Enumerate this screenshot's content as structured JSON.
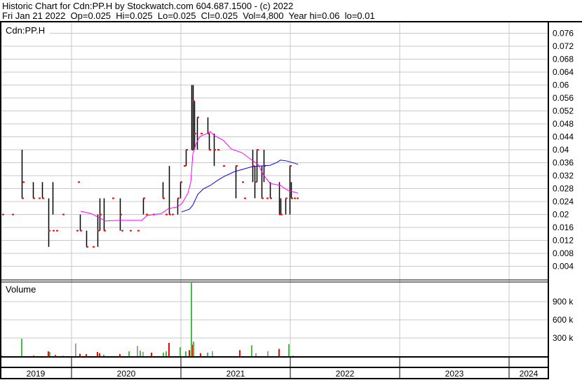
{
  "header": {
    "title": "Historic Chart for Cdn:PP.H by Stockwatch.com 604.687.1500 - (c) 2022",
    "summary": "Fri Jan 21 2022  Op=0.025  Hi=0.025  Lo=0.025  Cl=0.025  Vol=4,800  Year hi=0.06  lo=0.01"
  },
  "colors": {
    "close": "#ff0000",
    "ma_short": "#ff00ff",
    "ma_long": "#0000ff",
    "vol_up": "#44bb44",
    "vol_down": "#ff0000",
    "vol_flat": "#a0a0a0",
    "grid": "#c8c8c8"
  },
  "chart_data": [
    {
      "type": "line",
      "title": "Cdn:PP.H",
      "ylim": [
        0,
        0.08
      ],
      "y_ticks": [
        "0.004",
        "0.008",
        "0.012",
        "0.016",
        "0.02",
        "0.024",
        "0.028",
        "0.032",
        "0.036",
        "0.04",
        "0.044",
        "0.048",
        "0.052",
        "0.056",
        "0.06",
        "0.064",
        "0.068",
        "0.072",
        "0.076"
      ],
      "x_years": [
        "2019",
        "2020",
        "2021",
        "2022",
        "2023",
        "2024"
      ],
      "bars_t_hi_lo_close": [
        [
          2019.365,
          0.02,
          0.02,
          0.02
        ],
        [
          2019.455,
          0.02,
          0.02,
          0.02
        ],
        [
          2019.545,
          0.04,
          0.025,
          0.025
        ],
        [
          2019.551,
          0.03,
          0.03,
          0.03
        ],
        [
          2019.647,
          0.03,
          0.025,
          0.025
        ],
        [
          2019.699,
          0.025,
          0.025,
          0.025
        ],
        [
          2019.731,
          0.03,
          0.025,
          0.025
        ],
        [
          2019.788,
          0.025,
          0.01,
          0.015
        ],
        [
          2019.827,
          0.03,
          0.02,
          0.015
        ],
        [
          2019.859,
          0.015,
          0.015,
          0.015
        ],
        [
          2019.917,
          0.02,
          0.02,
          0.02
        ],
        [
          2020.045,
          0.015,
          0.015,
          0.015
        ],
        [
          2020.058,
          0.03,
          0.03,
          0.03
        ],
        [
          2020.077,
          0.02,
          0.015,
          0.015
        ],
        [
          2020.135,
          0.015,
          0.01,
          0.01
        ],
        [
          2020.192,
          0.01,
          0.01,
          0.01
        ],
        [
          2020.237,
          0.02,
          0.01,
          0.015
        ],
        [
          2020.256,
          0.025,
          0.015,
          0.02
        ],
        [
          2020.295,
          0.025,
          0.015,
          0.015
        ],
        [
          2020.372,
          0.025,
          0.025,
          0.025
        ],
        [
          2020.442,
          0.025,
          0.015,
          0.02
        ],
        [
          2020.455,
          0.02,
          0.02,
          0.015
        ],
        [
          2020.532,
          0.025,
          0.025,
          0.015
        ],
        [
          2020.603,
          0.015,
          0.015,
          0.015
        ],
        [
          2020.654,
          0.025,
          0.02,
          0.025
        ],
        [
          2020.679,
          0.03,
          0.03,
          0.02
        ],
        [
          2020.744,
          0.02,
          0.02,
          0.02
        ],
        [
          2020.833,
          0.03,
          0.025,
          0.025
        ],
        [
          2020.859,
          0.03,
          0.03,
          0.02
        ],
        [
          2020.891,
          0.035,
          0.02,
          0.02
        ],
        [
          2020.917,
          0.02,
          0.02,
          0.02
        ],
        [
          2020.968,
          0.025,
          0.02,
          0.025
        ],
        [
          2020.994,
          0.03,
          0.025,
          0.03
        ],
        [
          2021.026,
          0.035,
          0.035,
          0.035
        ],
        [
          2021.045,
          0.04,
          0.035,
          0.04
        ],
        [
          2021.096,
          0.06,
          0.04,
          0.04
        ],
        [
          2021.109,
          0.06,
          0.04,
          0.055
        ],
        [
          2021.122,
          0.055,
          0.04,
          0.045
        ],
        [
          2021.147,
          0.05,
          0.04,
          0.05
        ],
        [
          2021.179,
          0.045,
          0.045,
          0.045
        ],
        [
          2021.244,
          0.05,
          0.045,
          0.045
        ],
        [
          2021.256,
          0.045,
          0.04,
          0.04
        ],
        [
          2021.301,
          0.045,
          0.035,
          0.04
        ],
        [
          2021.333,
          0.04,
          0.04,
          0.04
        ],
        [
          2021.385,
          0.035,
          0.035,
          0.035
        ],
        [
          2021.5,
          0.035,
          0.025,
          0.035
        ],
        [
          2021.558,
          0.03,
          0.03,
          0.03
        ],
        [
          2021.577,
          0.025,
          0.025,
          0.025
        ],
        [
          2021.654,
          0.04,
          0.03,
          0.035
        ],
        [
          2021.673,
          0.035,
          0.025,
          0.03
        ],
        [
          2021.692,
          0.04,
          0.03,
          0.04
        ],
        [
          2021.737,
          0.035,
          0.025,
          0.025
        ],
        [
          2021.756,
          0.04,
          0.03,
          0.035
        ],
        [
          2021.782,
          0.025,
          0.025,
          0.025
        ],
        [
          2021.814,
          0.03,
          0.025,
          0.025
        ],
        [
          2021.897,
          0.03,
          0.02,
          0.02
        ],
        [
          2021.91,
          0.025,
          0.02,
          0.02
        ],
        [
          2021.955,
          0.025,
          0.02,
          0.025
        ],
        [
          2021.994,
          0.035,
          0.02,
          0.035
        ],
        [
          2022.006,
          0.03,
          0.025,
          0.025
        ],
        [
          2022.032,
          0.025,
          0.025,
          0.025
        ],
        [
          2022.058,
          0.025,
          0.025,
          0.025
        ]
      ],
      "series": [
        {
          "name": "ma_short",
          "points": [
            [
              2020.083,
              0.021
            ],
            [
              2020.179,
              0.0203
            ],
            [
              2020.276,
              0.0186
            ],
            [
              2020.308,
              0.018
            ],
            [
              2020.436,
              0.0182
            ],
            [
              2020.641,
              0.0182
            ],
            [
              2020.692,
              0.0197
            ],
            [
              2020.821,
              0.0203
            ],
            [
              2020.885,
              0.0218
            ],
            [
              2020.962,
              0.0223
            ],
            [
              2021.0,
              0.0231
            ],
            [
              2021.013,
              0.0236
            ],
            [
              2021.064,
              0.0266
            ],
            [
              2021.09,
              0.03
            ],
            [
              2021.109,
              0.0387
            ],
            [
              2021.141,
              0.042
            ],
            [
              2021.173,
              0.0441
            ],
            [
              2021.224,
              0.0448
            ],
            [
              2021.269,
              0.0456
            ],
            [
              2021.301,
              0.0445
            ],
            [
              2021.385,
              0.043
            ],
            [
              2021.462,
              0.0402
            ],
            [
              2021.558,
              0.0391
            ],
            [
              2021.641,
              0.037
            ],
            [
              2021.705,
              0.0355
            ],
            [
              2021.756,
              0.0322
            ],
            [
              2021.814,
              0.0296
            ],
            [
              2021.91,
              0.029
            ],
            [
              2021.974,
              0.0275
            ],
            [
              2022.071,
              0.0266
            ]
          ]
        },
        {
          "name": "ma_long",
          "points": [
            [
              2021.006,
              0.0208
            ],
            [
              2021.077,
              0.0216
            ],
            [
              2021.109,
              0.0229
            ],
            [
              2021.154,
              0.0262
            ],
            [
              2021.205,
              0.0279
            ],
            [
              2021.269,
              0.029
            ],
            [
              2021.333,
              0.0305
            ],
            [
              2021.397,
              0.0318
            ],
            [
              2021.494,
              0.0333
            ],
            [
              2021.558,
              0.0339
            ],
            [
              2021.654,
              0.0348
            ],
            [
              2021.814,
              0.0352
            ],
            [
              2021.878,
              0.0361
            ],
            [
              2021.91,
              0.0368
            ],
            [
              2021.974,
              0.0365
            ],
            [
              2022.071,
              0.0355
            ]
          ]
        }
      ]
    },
    {
      "type": "bar",
      "title": "Volume",
      "ylim": [
        0,
        1250
      ],
      "y_ticks": [
        "300 k",
        "600 k",
        "900 k"
      ],
      "y_tick_values": [
        300,
        600,
        900
      ],
      "bars_t_volume_k_dir": [
        [
          2019.365,
          10,
          "up"
        ],
        [
          2019.545,
          290,
          "up"
        ],
        [
          2019.654,
          15,
          "up"
        ],
        [
          2019.788,
          80,
          "down"
        ],
        [
          2019.801,
          70,
          "up"
        ],
        [
          2019.853,
          20,
          "down"
        ],
        [
          2019.923,
          10,
          "flat"
        ],
        [
          2020.038,
          210,
          "flat"
        ],
        [
          2020.077,
          40,
          "down"
        ],
        [
          2020.135,
          35,
          "down"
        ],
        [
          2020.237,
          70,
          "down"
        ],
        [
          2020.256,
          50,
          "down"
        ],
        [
          2020.295,
          25,
          "up"
        ],
        [
          2020.442,
          35,
          "down"
        ],
        [
          2020.526,
          80,
          "up"
        ],
        [
          2020.603,
          170,
          "flat"
        ],
        [
          2020.628,
          90,
          "up"
        ],
        [
          2020.654,
          70,
          "flat"
        ],
        [
          2020.731,
          60,
          "down"
        ],
        [
          2020.84,
          60,
          "up"
        ],
        [
          2020.865,
          80,
          "up"
        ],
        [
          2020.891,
          220,
          "down"
        ],
        [
          2020.994,
          150,
          "up"
        ],
        [
          2021.045,
          80,
          "up"
        ],
        [
          2021.077,
          100,
          "down"
        ],
        [
          2021.096,
          1210,
          "up"
        ],
        [
          2021.109,
          190,
          "down"
        ],
        [
          2021.115,
          240,
          "up"
        ],
        [
          2021.179,
          50,
          "down"
        ],
        [
          2021.244,
          60,
          "up"
        ],
        [
          2021.288,
          85,
          "flat"
        ],
        [
          2021.538,
          100,
          "down"
        ],
        [
          2021.647,
          180,
          "up"
        ],
        [
          2021.686,
          50,
          "flat"
        ],
        [
          2021.795,
          85,
          "flat"
        ],
        [
          2021.897,
          120,
          "down"
        ],
        [
          2021.987,
          200,
          "up"
        ],
        [
          2022.026,
          10,
          "flat"
        ]
      ]
    }
  ]
}
